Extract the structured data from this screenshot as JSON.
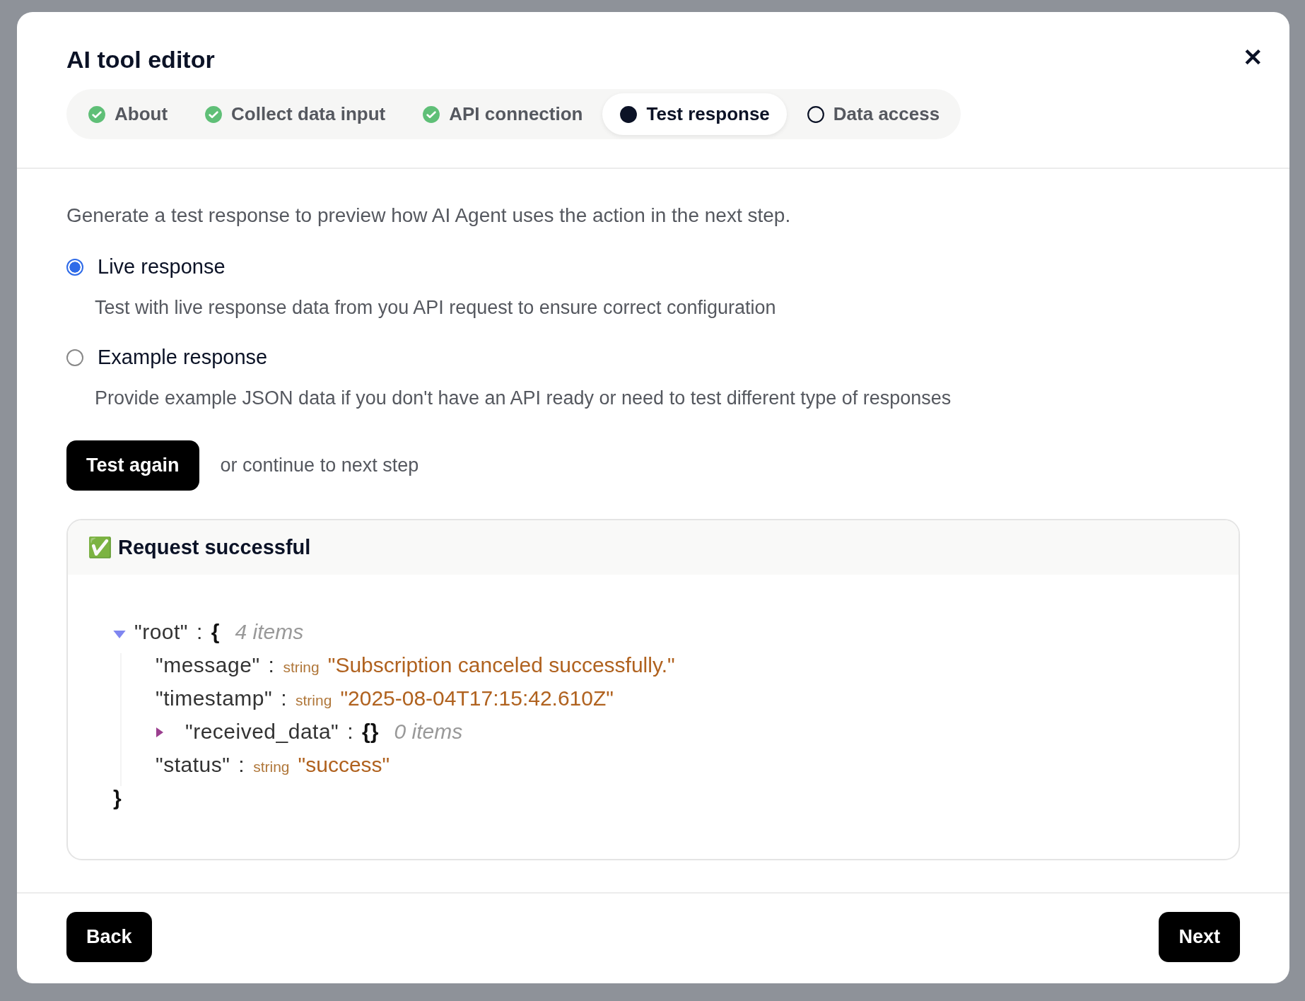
{
  "dialog": {
    "title": "AI tool editor",
    "close": "✕"
  },
  "steps": [
    {
      "label": "About",
      "kind": "done",
      "selected": false
    },
    {
      "label": "Collect data input",
      "kind": "done",
      "selected": false
    },
    {
      "label": "API connection",
      "kind": "done",
      "selected": false
    },
    {
      "label": "Test response",
      "kind": "current",
      "selected": true
    },
    {
      "label": "Data access",
      "kind": "todo",
      "selected": false
    }
  ],
  "intro": "Generate a test response to preview how AI Agent uses the action in the next step.",
  "options": [
    {
      "label": "Live response",
      "description": "Test with live response data from you API request to ensure correct configuration",
      "selected": true
    },
    {
      "label": "Example response",
      "description": "Provide example JSON data if you don't have an API ready or need to test different type of responses",
      "selected": false
    }
  ],
  "test_button": "Test again",
  "continue_hint": "or continue to next step",
  "result": {
    "emoji": "✅",
    "title": "Request successful",
    "tree": {
      "key": "\"root\"",
      "colon": ":",
      "open": "{",
      "count": "4 items",
      "expanded": true,
      "close": "}",
      "children": [
        {
          "kind": "value",
          "key": "\"message\"",
          "colon": ":",
          "type": "string",
          "value": "\"Subscription canceled successfully.\""
        },
        {
          "kind": "value",
          "key": "\"timestamp\"",
          "colon": ":",
          "type": "string",
          "value": "\"2025-08-04T17:15:42.610Z\""
        },
        {
          "kind": "object",
          "key": "\"received_data\"",
          "colon": ":",
          "braces": "{}",
          "count": "0 items",
          "expanded": false
        },
        {
          "kind": "value",
          "key": "\"status\"",
          "colon": ":",
          "type": "string",
          "value": "\"success\""
        }
      ]
    }
  },
  "footer": {
    "back": "Back",
    "next": "Next"
  }
}
